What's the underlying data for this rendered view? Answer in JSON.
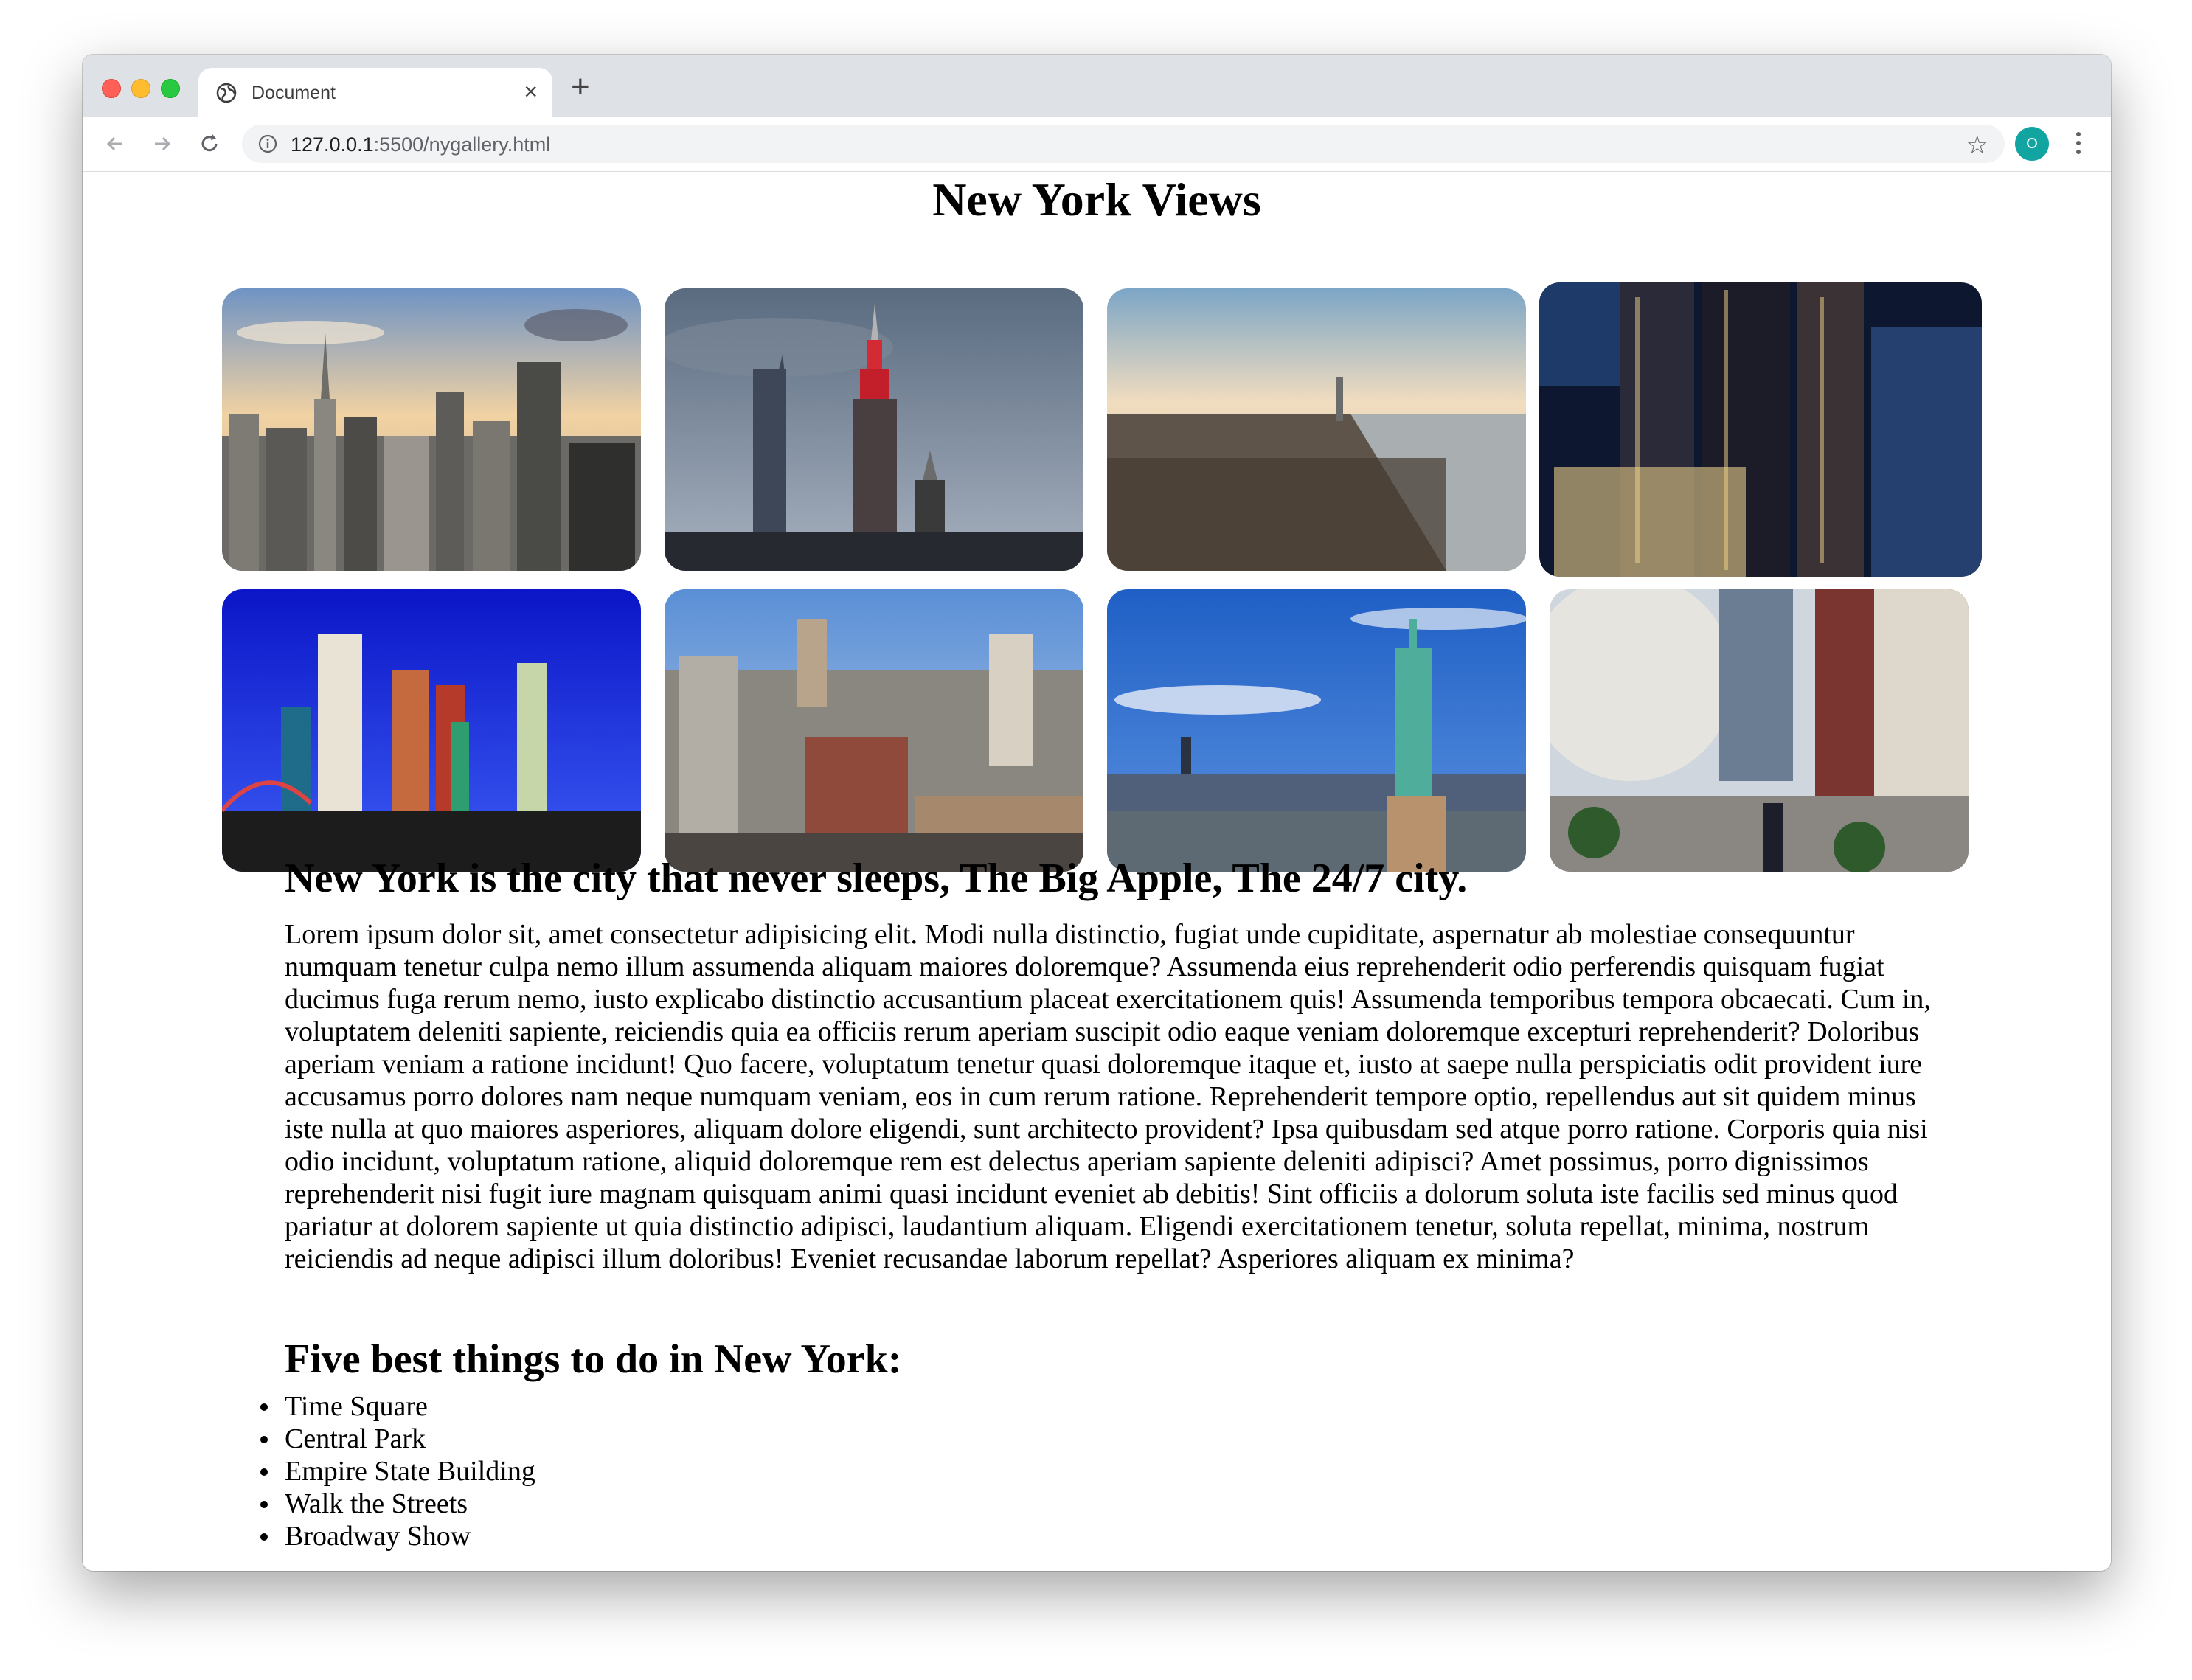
{
  "browser": {
    "tab_title": "Document",
    "tab_close": "×",
    "new_tab": "+",
    "url_host": "127.0.0.1",
    "url_path": ":5500/nygallery.html",
    "profile_initial": "O",
    "accent_color": "#12a4a1"
  },
  "page": {
    "title": "New York Views",
    "gallery": [
      {
        "name": "skyline-sunset",
        "icon": "photo"
      },
      {
        "name": "empire-state-building",
        "icon": "photo"
      },
      {
        "name": "hudson-river-aerial",
        "icon": "photo"
      },
      {
        "name": "night-towers",
        "icon": "photo"
      },
      {
        "name": "new-york-new-york-casino",
        "icon": "photo"
      },
      {
        "name": "manhattan-rooftops",
        "icon": "photo"
      },
      {
        "name": "statue-of-liberty",
        "icon": "photo"
      },
      {
        "name": "street-plaza",
        "icon": "photo"
      }
    ],
    "heading": "New York is the city that never sleeps, The Big Apple, The 24/7 city.",
    "paragraph": "Lorem ipsum dolor sit, amet consectetur adipisicing elit. Modi nulla distinctio, fugiat unde cupiditate, aspernatur ab molestiae consequuntur numquam tenetur culpa nemo illum assumenda aliquam maiores doloremque? Assumenda eius reprehenderit odio perferendis quisquam fugiat ducimus fuga rerum nemo, iusto explicabo distinctio accusantium placeat exercitationem quis! Assumenda temporibus tempora obcaecati. Cum in, voluptatem deleniti sapiente, reiciendis quia ea officiis rerum aperiam suscipit odio eaque veniam doloremque excepturi reprehenderit? Doloribus aperiam veniam a ratione incidunt! Quo facere, voluptatum tenetur quasi doloremque itaque et, iusto at saepe nulla perspiciatis odit provident iure accusamus porro dolores nam neque numquam veniam, eos in cum rerum ratione. Reprehenderit tempore optio, repellendus aut sit quidem minus iste nulla at quo maiores asperiores, aliquam dolore eligendi, sunt architecto provident? Ipsa quibusdam sed atque porro ratione. Corporis quia nisi odio incidunt, voluptatum ratione, aliquid doloremque rem est delectus aperiam sapiente deleniti adipisci? Amet possimus, porro dignissimos reprehenderit nisi fugit iure magnam quisquam animi quasi incidunt eveniet ab debitis! Sint officiis a dolorum soluta iste facilis sed minus quod pariatur at dolorem sapiente ut quia distinctio adipisci, laudantium aliquam. Eligendi exercitationem tenetur, soluta repellat, minima, nostrum reiciendis ad neque adipisci illum doloribus! Eveniet recusandae laborum repellat? Asperiores aliquam ex minima?",
    "list_heading": "Five best things to do in New York:",
    "list": [
      "Time Square",
      "Central Park",
      "Empire State Building",
      "Walk the Streets",
      "Broadway Show"
    ]
  }
}
